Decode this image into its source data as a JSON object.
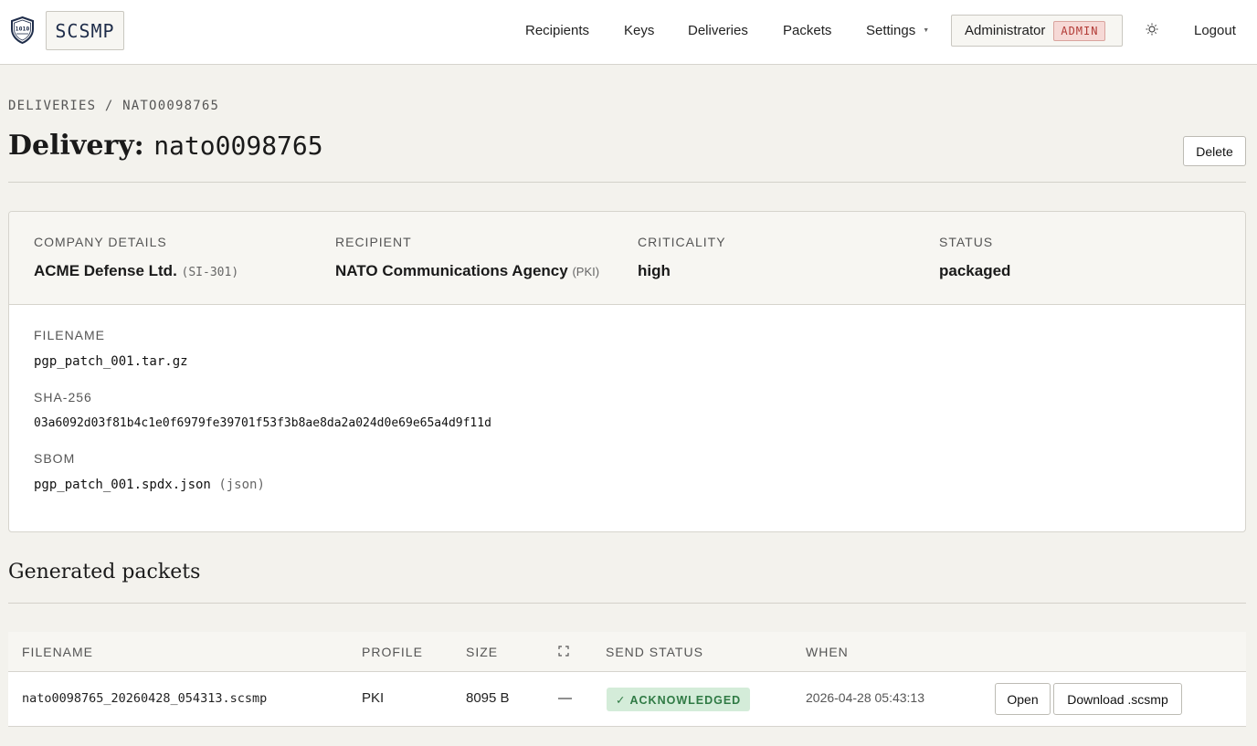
{
  "brand": {
    "name": "SCSMP"
  },
  "nav": {
    "items": [
      "Recipients",
      "Keys",
      "Deliveries",
      "Packets",
      "Settings"
    ],
    "user": "Administrator",
    "role_badge": "ADMIN",
    "logout": "Logout"
  },
  "page": {
    "breadcrumb": "DELIVERIES / NATO0098765",
    "title_prefix": "Delivery:",
    "title_id": "nato0098765",
    "delete_label": "Delete"
  },
  "details": {
    "company_label": "COMPANY DETAILS",
    "company_name": "ACME Defense Ltd.",
    "company_code": "(SI-301)",
    "recipient_label": "RECIPIENT",
    "recipient_name": "NATO Communications Agency",
    "recipient_code": "(PKI)",
    "criticality_label": "CRITICALITY",
    "criticality": "high",
    "status_label": "STATUS",
    "status": "packaged",
    "filename_label": "FILENAME",
    "filename": "pgp_patch_001.tar.gz",
    "sha_label": "SHA-256",
    "sha": "03a6092d03f81b4c1e0f6979fe39701f53f3b8ae8da2a024d0e69e65a4d9f11d",
    "sbom_label": "SBOM",
    "sbom_file": "pgp_patch_001.spdx.json",
    "sbom_format": "(json)"
  },
  "packets": {
    "heading": "Generated packets",
    "columns": [
      "FILENAME",
      "PROFILE",
      "SIZE",
      "SEND STATUS",
      "WHEN"
    ],
    "rows": [
      {
        "filename": "nato0098765_20260428_054313.scsmp",
        "profile": "PKI",
        "size": "8095 B",
        "fullscreen": "—",
        "status": "✓ ACKNOWLEDGED",
        "when": "2026-04-28 05:43:13",
        "open_label": "Open",
        "download_label": "Download .scsmp"
      }
    ]
  },
  "icons": {
    "logo": "shield-1010-icon",
    "theme": "sun-icon",
    "expand": "expand-icon",
    "caret": "caret-down-icon"
  }
}
